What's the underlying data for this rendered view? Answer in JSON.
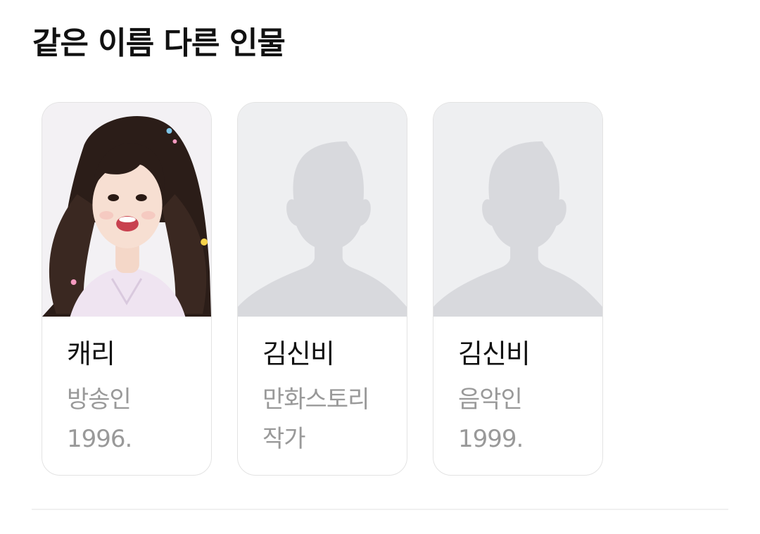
{
  "section": {
    "title": "같은 이름 다른 인물"
  },
  "people": [
    {
      "name": "캐리",
      "occupation": "방송인",
      "birth": "1996.",
      "thumbnail": "person-photo"
    },
    {
      "name": "김신비",
      "occupation": "만화스토리",
      "occupation_line2": "작가",
      "thumbnail": "default-avatar-icon"
    },
    {
      "name": "김신비",
      "occupation": "음악인",
      "birth": "1999.",
      "thumbnail": "default-avatar-icon"
    }
  ],
  "colors": {
    "placeholder_bg": "#eeeff1",
    "silhouette": "#d8d9dd",
    "name_text": "#111111",
    "meta_text": "#999999",
    "card_border": "#e3e3e3"
  }
}
